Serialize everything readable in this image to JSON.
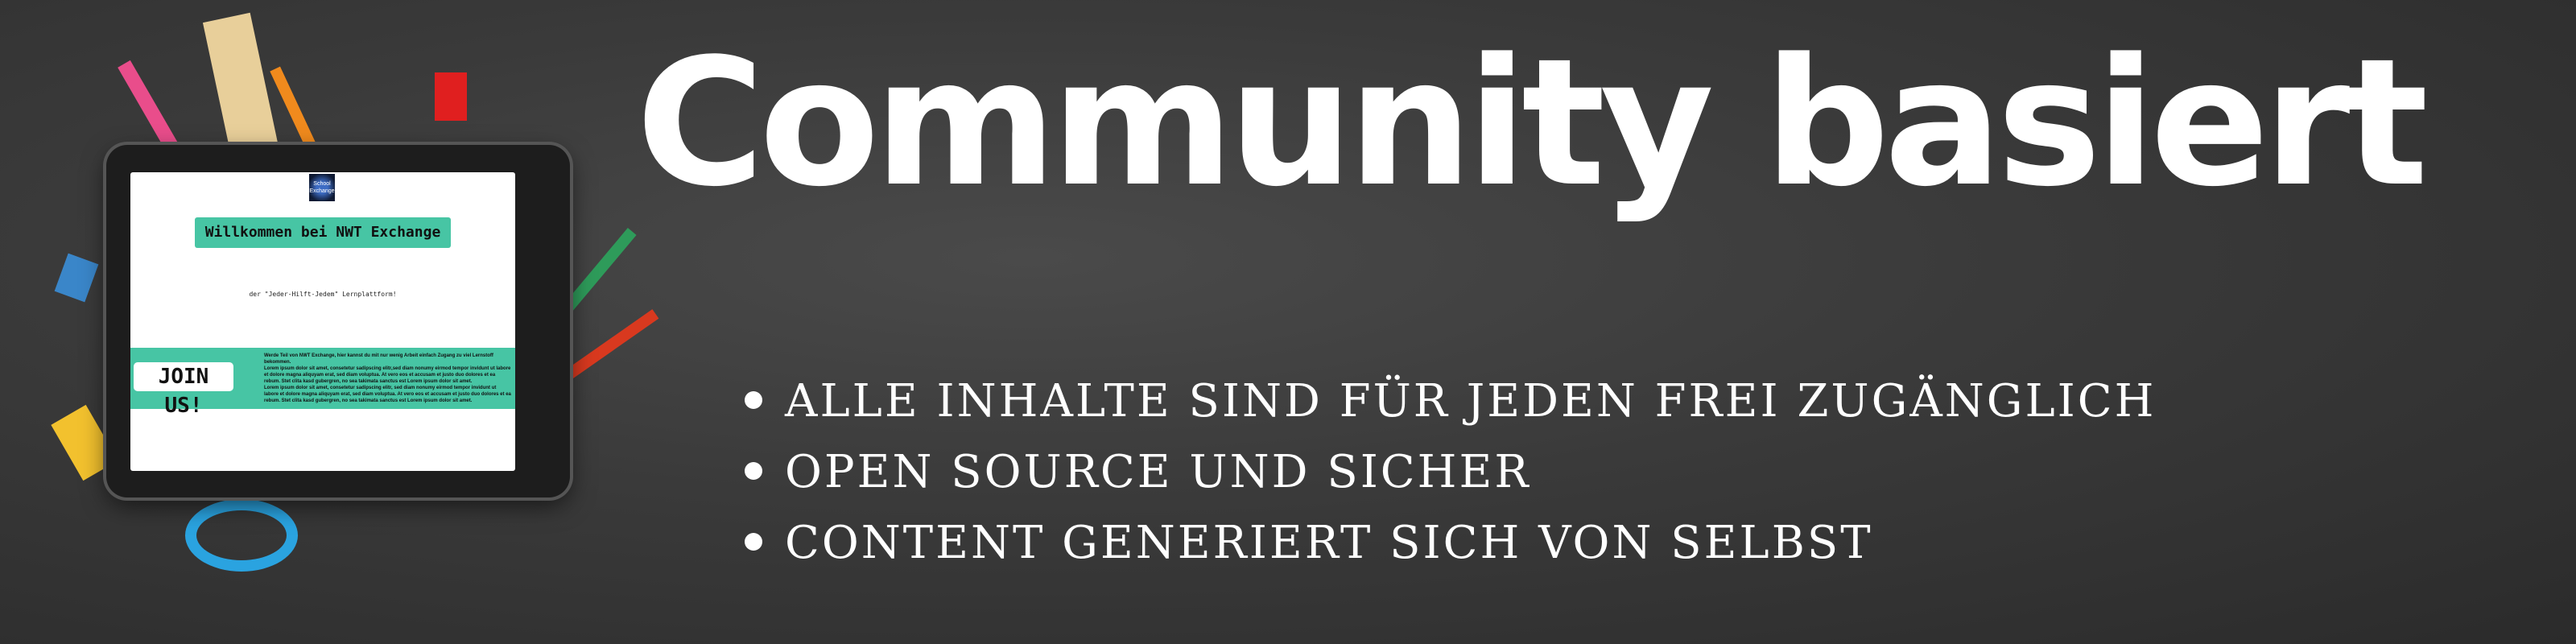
{
  "headline": "Community basiert",
  "bullets": [
    "ALLE INHALTE SIND FÜR JEDEN FREI ZUGÄNGLICH",
    "OPEN SOURCE UND SICHER",
    "CONTENT GENERIERT SICH VON SELBST"
  ],
  "tablet": {
    "logo_text": "School Exchange",
    "welcome": "Willkommen bei NWT Exchange",
    "subtitle": "der \"Jeder-Hilft-Jedem\" Lernplattform!",
    "join_label": "JOIN US!",
    "description": [
      "Werde Teil von NWT Exchange, hier kannst du mit nur wenig Arbeit einfach Zugang zu viel Lernstoff bekommen.",
      "Lorem ipsum dolor sit amet, consetetur sadipscing elitr,sed diam nonumy eirmod tempor invidunt ut labore et dolore magna aliquyam erat, sed diam voluptua. At vero eos et accusam et justo duo dolores et ea rebum. Stet clita kasd gubergren, no sea takimata sanctus est Lorem ipsum dolor sit amet.",
      "Lorem ipsum dolor sit amet, consetetur sadipscing elitr, sed diam nonumy eirmod tempor invidunt ut labore et dolore magna aliquyam erat, sed diam voluptua. At vero eos et accusam et justo duo dolores et ea rebum. Stet clita kasd gubergren, no sea takimata sanctus est Lorem ipsum dolor sit amet."
    ],
    "accent": "#47c5a4"
  }
}
